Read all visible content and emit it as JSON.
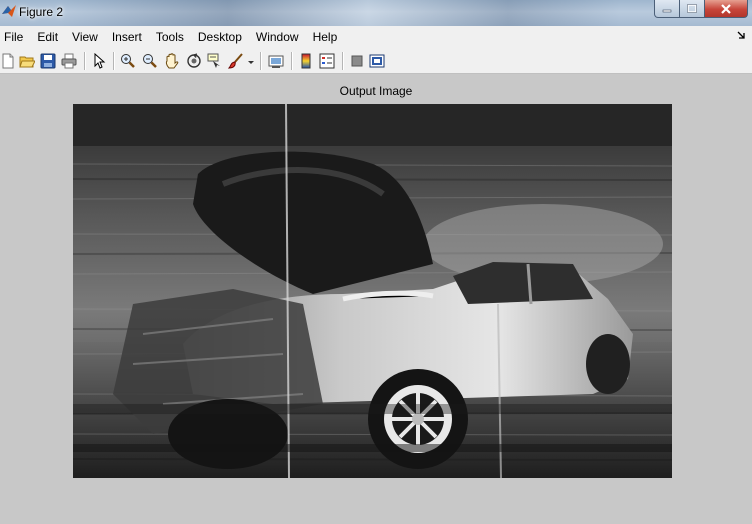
{
  "window": {
    "title": "Figure 2",
    "icon": "matlab-icon",
    "controls": [
      "minimize-icon",
      "maximize-icon",
      "close-icon"
    ]
  },
  "menu": {
    "items": [
      "File",
      "Edit",
      "View",
      "Insert",
      "Tools",
      "Desktop",
      "Window",
      "Help"
    ],
    "overflow_icon": "dock-arrow-icon"
  },
  "toolbar": {
    "icons": [
      "new-figure-icon",
      "open-file-icon",
      "save-icon",
      "print-icon",
      "edit-plot-icon",
      "zoom-in-icon",
      "zoom-out-icon",
      "pan-icon",
      "rotate-3d-icon",
      "data-cursor-icon",
      "brush-icon",
      "brush-dropdown-icon",
      "link-plot-icon",
      "insert-colorbar-icon",
      "insert-legend-icon",
      "hide-plot-tools-icon",
      "show-plot-tools-icon"
    ]
  },
  "axes": {
    "title": "Output Image",
    "image_description_icon": "grayscale-car-image"
  },
  "colors": {
    "figure_bg": "#c8c8c8",
    "bar_bg": "#f0f0f0",
    "close_red": "#c7453a"
  }
}
